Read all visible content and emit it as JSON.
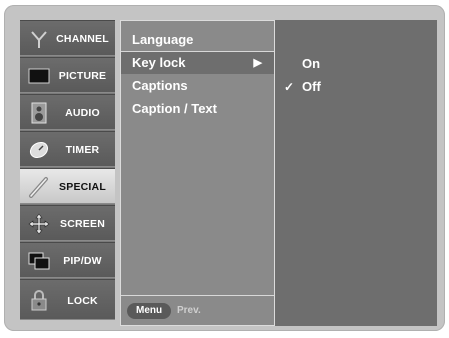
{
  "sidebar": {
    "items": [
      {
        "label": "CHANNEL",
        "icon": "antenna-icon",
        "active": false
      },
      {
        "label": "PICTURE",
        "icon": "tv-screen-icon",
        "active": false
      },
      {
        "label": "AUDIO",
        "icon": "speaker-icon",
        "active": false
      },
      {
        "label": "TIMER",
        "icon": "clock-icon",
        "active": false
      },
      {
        "label": "SPECIAL",
        "icon": "magic-wand-icon",
        "active": true
      },
      {
        "label": "SCREEN",
        "icon": "move-arrows-icon",
        "active": false
      },
      {
        "label": "PIP/DW",
        "icon": "pip-windows-icon",
        "active": false
      },
      {
        "label": "LOCK",
        "icon": "padlock-icon",
        "active": false
      }
    ]
  },
  "menu": {
    "items": [
      "Language",
      "Key lock",
      "Captions",
      "Caption / Text"
    ],
    "selected_index": 1,
    "arrow": "▶"
  },
  "submenu": {
    "options": [
      {
        "label": "On",
        "checked": false
      },
      {
        "label": "Off",
        "checked": true
      }
    ],
    "check_glyph": "✓"
  },
  "footer": {
    "menu_key": "Menu",
    "prev_label": "Prev."
  },
  "colors": {
    "frame": "#c4c4c4",
    "sidebar_item": "#5a5a5a",
    "sidebar_active": "#d8d8d8",
    "menu_bg": "#8a8a8a",
    "submenu_bg": "#6e6e6e",
    "text": "#ffffff"
  }
}
